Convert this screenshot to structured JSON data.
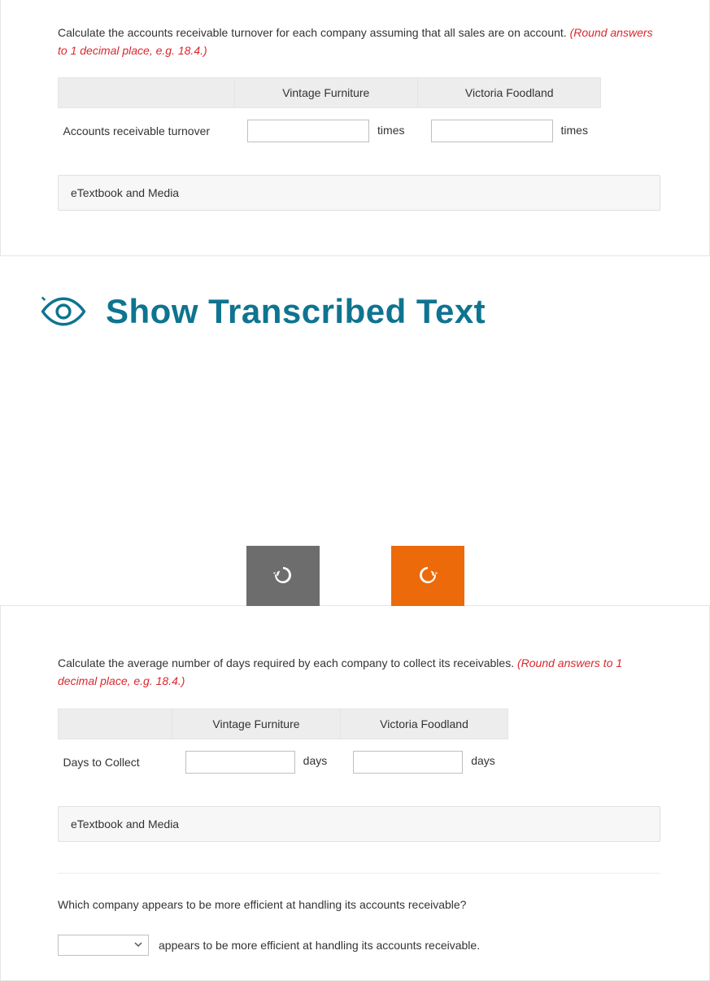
{
  "section1": {
    "question_prefix": "Calculate the accounts receivable turnover for each company assuming that all sales are on account. ",
    "question_hint": "(Round answers to 1 decimal place, e.g. 18.4.)",
    "headers": {
      "col1": "Vintage Furniture",
      "col2": "Victoria Foodland"
    },
    "row_label": "Accounts receivable turnover",
    "unit": "times",
    "etextbook_label": "eTextbook and Media"
  },
  "show_transcribed_label": "Show Transcribed Text",
  "section2": {
    "question_prefix": "Calculate the average number of days required by each company to collect its receivables. ",
    "question_hint": "(Round answers to 1 decimal place, e.g. 18.4.)",
    "headers": {
      "col1": "Vintage Furniture",
      "col2": "Victoria Foodland"
    },
    "row_label": "Days to Collect",
    "unit": "days",
    "etextbook_label": "eTextbook and Media"
  },
  "efficiency": {
    "question": "Which company appears to be more efficient at handling its accounts receivable?",
    "suffix": "appears to be more efficient at handling its accounts receivable."
  }
}
